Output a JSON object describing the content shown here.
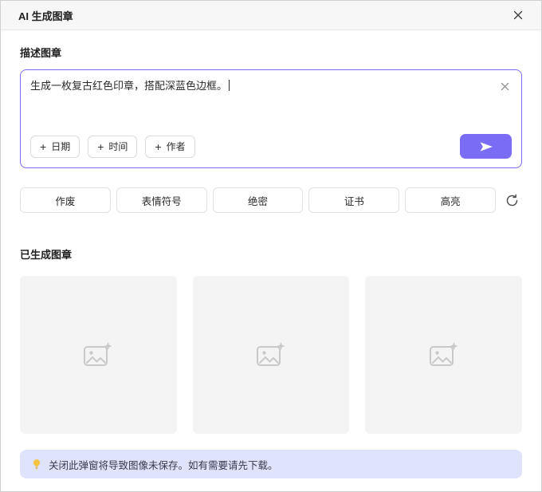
{
  "dialog": {
    "title": "AI 生成图章"
  },
  "describe": {
    "label": "描述图章",
    "value": "生成一枚复古红色印章，搭配深蓝色边框。",
    "chips": [
      "日期",
      "时间",
      "作者"
    ]
  },
  "suggestions": {
    "items": [
      "作废",
      "表情符号",
      "绝密",
      "证书",
      "高亮"
    ]
  },
  "generated": {
    "label": "已生成图章",
    "card_count": 3
  },
  "notice": {
    "text": "关闭此弹窗将导致图像未保存。如有需要请先下载。"
  },
  "icons": {
    "plus": "+",
    "close": "✕",
    "clear": "✕",
    "send": "paper-plane",
    "refresh": "circular-arrow",
    "bulb": "💡",
    "placeholder": "image-with-sparkle"
  },
  "colors": {
    "accent": "#7b6cf6",
    "notice_bg": "#dfe4fc",
    "card_bg": "#f4f4f5"
  }
}
